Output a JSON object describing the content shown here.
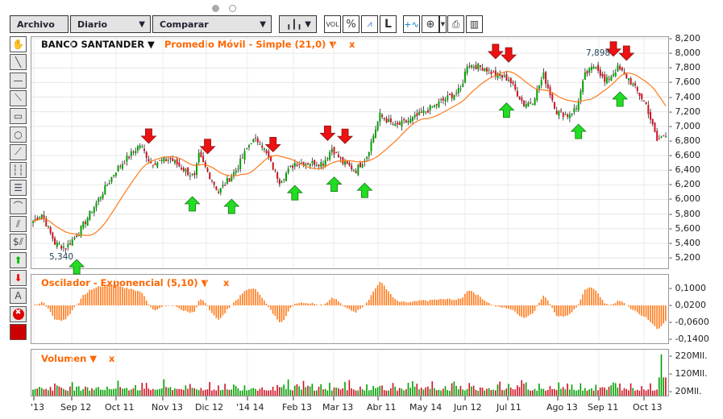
{
  "toolbar": {
    "archivo": "Archivo",
    "period": "Diario",
    "compare": "Comparar",
    "vol": "VOL",
    "percent": "%",
    "log": "L"
  },
  "main": {
    "symbol": "BANCO SANTANDER ▼",
    "indicator": "Promedio Móvil - Simple (21,0) ▼",
    "indicator_close": "x",
    "min_label": "5,340",
    "max_label": "7,898"
  },
  "oscillator": {
    "title": "Oscilador - Exponencial (5,10) ▼",
    "close": "x",
    "ticks": [
      "0,1000",
      "0,0200",
      "-0,0600",
      "-0,1400"
    ]
  },
  "volume": {
    "title": "Volumen ▼",
    "close": "x",
    "ticks": [
      "220Mll.",
      "120Mll.",
      "20Mll."
    ]
  },
  "price_ticks": [
    "8,200",
    "8,000",
    "7,800",
    "7,600",
    "7,400",
    "7,200",
    "7,000",
    "6,800",
    "6,600",
    "6,400",
    "6,200",
    "6,000",
    "5,800",
    "5,600",
    "5,400",
    "5,200"
  ],
  "x_labels": [
    "'13",
    "Sep 12",
    "Oct 11",
    "Nov 13",
    "Dic 12",
    "'14 14",
    "Feb 13",
    "Mar 13",
    "Abr 11",
    "May 14",
    "Jun 12",
    "Jul 11",
    "Ago 13",
    "Sep 11",
    "Oct 13"
  ],
  "colors": {
    "up": "#00a000",
    "down": "#d01020",
    "sma": "#ff7a1a",
    "osc": "#ff7a1a",
    "accent": "#ff6600"
  },
  "chart_data": {
    "type": "candlestick",
    "days": 290,
    "ylim": [
      5200,
      8200
    ],
    "keypoints": [
      [
        0,
        5700
      ],
      [
        4,
        5800
      ],
      [
        10,
        5400
      ],
      [
        15,
        5340
      ],
      [
        21,
        5550
      ],
      [
        30,
        6000
      ],
      [
        38,
        6400
      ],
      [
        49,
        6750
      ],
      [
        54,
        6500
      ],
      [
        63,
        6550
      ],
      [
        74,
        6300
      ],
      [
        76,
        6600
      ],
      [
        85,
        6100
      ],
      [
        93,
        6400
      ],
      [
        100,
        6800
      ],
      [
        104,
        6800
      ],
      [
        113,
        6250
      ],
      [
        120,
        6500
      ],
      [
        133,
        6500
      ],
      [
        137,
        6700
      ],
      [
        142,
        6500
      ],
      [
        148,
        6400
      ],
      [
        153,
        6600
      ],
      [
        159,
        7150
      ],
      [
        166,
        7000
      ],
      [
        174,
        7100
      ],
      [
        185,
        7300
      ],
      [
        196,
        7500
      ],
      [
        199,
        7850
      ],
      [
        207,
        7800
      ],
      [
        212,
        7700
      ],
      [
        218,
        7650
      ],
      [
        225,
        7300
      ],
      [
        229,
        7350
      ],
      [
        234,
        7700
      ],
      [
        240,
        7200
      ],
      [
        245,
        7150
      ],
      [
        249,
        7250
      ],
      [
        253,
        7700
      ],
      [
        258,
        7850
      ],
      [
        262,
        7600
      ],
      [
        268,
        7800
      ],
      [
        273,
        7650
      ],
      [
        281,
        7300
      ],
      [
        286,
        6800
      ],
      [
        290,
        6900
      ]
    ],
    "buy_signals": [
      20,
      73,
      91,
      120,
      138,
      152,
      217,
      250,
      269
    ],
    "sell_signals": [
      53,
      80,
      110,
      135,
      143,
      212,
      218,
      266,
      272
    ],
    "sma_period": 21,
    "oscillator": [
      5,
      10
    ],
    "osc_ylim": [
      -0.16,
      0.14
    ],
    "vol_ylim": [
      0,
      240
    ]
  }
}
